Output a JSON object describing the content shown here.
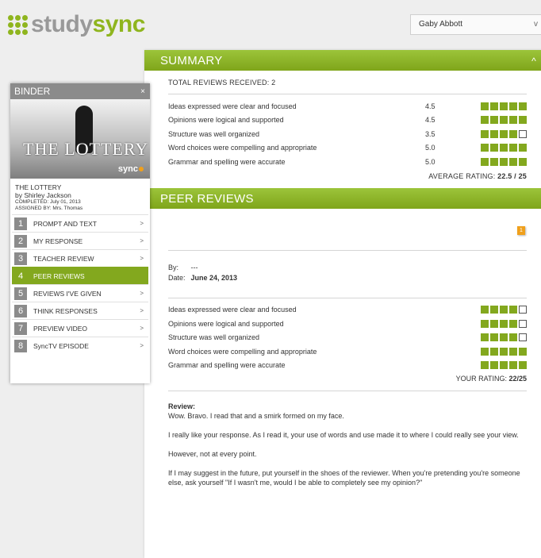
{
  "header": {
    "logo_prefix": "study",
    "logo_suffix": "sync",
    "user_name": "Gaby Abbott",
    "user_menu_caret": "v"
  },
  "summary": {
    "title": "SUMMARY",
    "collapse_icon": "^",
    "total": "TOTAL REVIEWS RECEIVED: 2",
    "rows": [
      {
        "label": "Ideas expressed were clear and focused",
        "score": "4.5",
        "filled": 5
      },
      {
        "label": "Opinions were logical and supported",
        "score": "4.5",
        "filled": 5
      },
      {
        "label": "Structure was well organized",
        "score": "3.5",
        "filled": 4
      },
      {
        "label": "Word choices were compelling and appropriate",
        "score": "5.0",
        "filled": 5
      },
      {
        "label": "Grammar and spelling were accurate",
        "score": "5.0",
        "filled": 5
      }
    ],
    "avg_label": "AVERAGE RATING:",
    "avg_value": "22.5 / 25"
  },
  "peer": {
    "title": "PEER REVIEWS",
    "flag_count": "1",
    "by_label": "By:",
    "by_value": "---",
    "date_label": "Date:",
    "date_value": "June 24, 2013",
    "rows": [
      {
        "label": "Ideas expressed were clear and focused",
        "filled": 4
      },
      {
        "label": "Opinions were logical and supported",
        "filled": 4
      },
      {
        "label": "Structure was well organized",
        "filled": 4
      },
      {
        "label": "Word choices were compelling and appropriate",
        "filled": 5
      },
      {
        "label": "Grammar and spelling were accurate",
        "filled": 5
      }
    ],
    "your_label": "YOUR RATING:",
    "your_value": "22/25",
    "review_label": "Review:",
    "review_paragraphs": [
      "Wow. Bravo. I read that and a smirk formed on my face.",
      "I really like your response. As I read it, your use of words and use made it to where I could really see your view.",
      "However, not at every point.",
      "If I may suggest in the future, put yourself in the shoes of the reviewer. When you're pretending you're someone else, ask yourself \"If I wasn't me, would I be able to completely see my opinion?\""
    ]
  },
  "binder": {
    "title": "BINDER",
    "close": "×",
    "cover_title": "THE LOTTERY",
    "cover_brand": "sync",
    "book_title": "THE LOTTERY",
    "author": "by Shirley Jackson",
    "completed": "COMPLETED: July 01, 2013",
    "assigned": "ASSIGNED BY: Mrs. Thomas",
    "items": [
      {
        "num": "1",
        "label": "PROMPT AND TEXT",
        "arrow": ">"
      },
      {
        "num": "2",
        "label": "MY RESPONSE",
        "arrow": ">"
      },
      {
        "num": "3",
        "label": "TEACHER REVIEW",
        "arrow": ">"
      },
      {
        "num": "4",
        "label": "PEER REVIEWS",
        "arrow": ""
      },
      {
        "num": "5",
        "label": "REVIEWS I'VE GIVEN",
        "arrow": ">"
      },
      {
        "num": "6",
        "label": "THINK RESPONSES",
        "arrow": ">"
      },
      {
        "num": "7",
        "label": "PREVIEW VIDEO",
        "arrow": ">"
      },
      {
        "num": "8",
        "label": "SyncTV EPISODE",
        "arrow": ">"
      }
    ],
    "active_index": 3
  }
}
